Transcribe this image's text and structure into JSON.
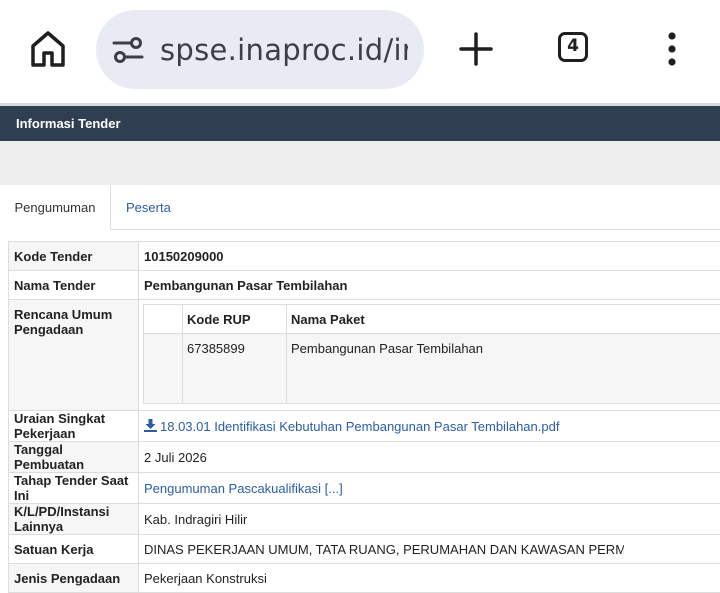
{
  "browser": {
    "url": "spse.inaproc.id/ir",
    "tab_count": "4",
    "icons": [
      "home-icon",
      "site-settings-icon",
      "plus-icon",
      "tab-switcher-icon",
      "more-vert-icon"
    ]
  },
  "page": {
    "header_title": "Informasi Tender",
    "header_color": "#2f3e50"
  },
  "tabs": [
    {
      "label": "Pengumuman",
      "active": true
    },
    {
      "label": "Peserta",
      "active": false
    }
  ],
  "info": {
    "kode_tender": {
      "label": "Kode Tender",
      "value": "10150209000"
    },
    "nama_tender": {
      "label": "Nama Tender",
      "value": "Pembangunan Pasar Tembilahan"
    },
    "rup": {
      "label": "Rencana Umum Pengadaan",
      "headers": [
        "Kode RUP",
        "Nama Paket"
      ],
      "rows": [
        {
          "kode": "67385899",
          "nama": "Pembangunan Pasar Tembilahan"
        }
      ]
    },
    "uraian": {
      "label": "Uraian Singkat Pekerjaan",
      "value": "18.03.01 Identifikasi Kebutuhan Pembangunan Pasar Tembilahan.pdf"
    },
    "tanggal": {
      "label": "Tanggal Pembuatan",
      "value": "2 Juli 2026"
    },
    "tahap": {
      "label": "Tahap Tender Saat Ini",
      "value": "Pengumuman Pascakualifikasi [...]"
    },
    "instansi": {
      "label": "K/L/PD/Instansi Lainnya",
      "value": "Kab. Indragiri Hilir"
    },
    "satker": {
      "label": "Satuan Kerja",
      "value": "DINAS PEKERJAAN UMUM, TATA RUANG, PERUMAHAN DAN KAWASAN PERM"
    },
    "jenis": {
      "label": "Jenis Pengadaan",
      "value": "Pekerjaan Konstruksi"
    }
  }
}
